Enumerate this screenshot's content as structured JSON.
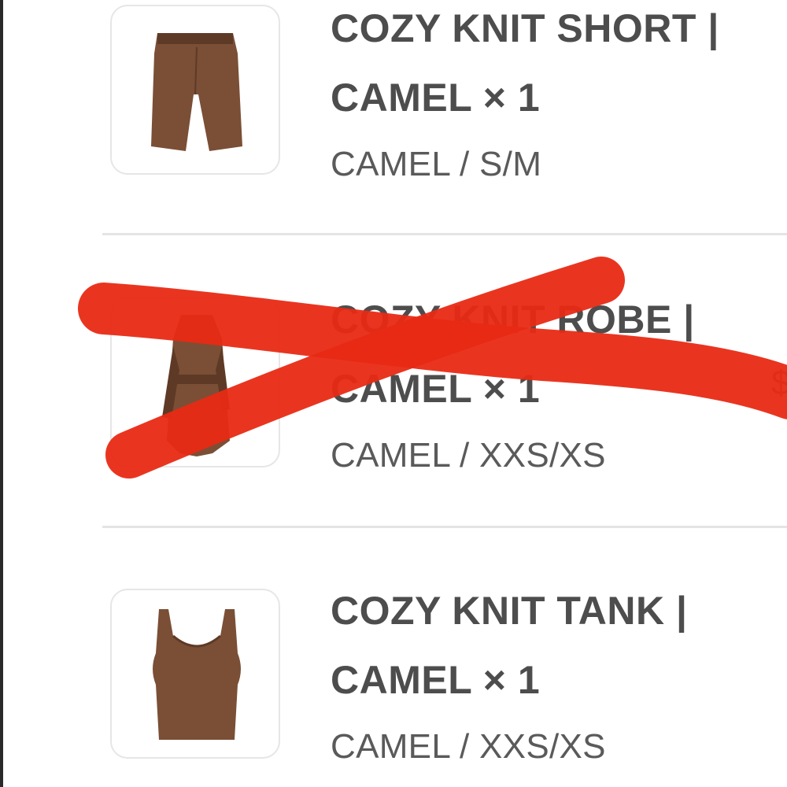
{
  "items": [
    {
      "title": "COZY KNIT SHORT | CAMEL × 1",
      "variant": "CAMEL / S/M",
      "image_icon": "shorts-icon",
      "crossed_out": false
    },
    {
      "title": "COZY KNIT ROBE | CAMEL × 1",
      "variant": "CAMEL / XXS/XS",
      "image_icon": "robe-icon",
      "crossed_out": true
    },
    {
      "title": "COZY KNIT TANK | CAMEL × 1",
      "variant": "CAMEL / XXS/XS",
      "image_icon": "tank-top-icon",
      "crossed_out": false
    }
  ],
  "price_fragment": "$",
  "colors": {
    "product": "#7a4f36",
    "product_dark": "#5e3a26",
    "scribble": "#e82a14",
    "text": "#4d4d4d",
    "divider": "#e4e4e4"
  }
}
